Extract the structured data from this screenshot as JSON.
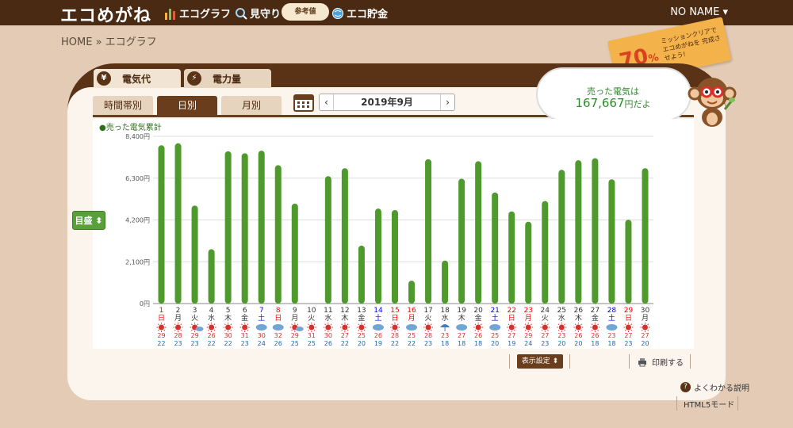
{
  "header": {
    "logo": "エコめがね",
    "nav": [
      {
        "label": "エコグラフ",
        "icon": "bar-chart-icon"
      },
      {
        "label": "見守り",
        "icon": "magnifier-icon"
      },
      {
        "label": "エコ貯金",
        "icon": "globe-coin-icon"
      }
    ],
    "ref_badge": "参考値",
    "user": "NO NAME ▾"
  },
  "breadcrumb": "HOME » エコグラフ",
  "mission": {
    "percent": "70",
    "percent_unit": "%",
    "text": "ミッションクリアで エコめがねを 完成させよう!"
  },
  "tabs": [
    {
      "label": "電気代",
      "icon": "yen-icon"
    },
    {
      "label": "電力量",
      "icon": "bolt-icon"
    }
  ],
  "subtabs": [
    "時間帯別",
    "日別",
    "月別"
  ],
  "active_subtab": 1,
  "date_label": "2019年9月",
  "bubble": {
    "line1": "売った電気は",
    "value": "167,667",
    "unit": "円だよ"
  },
  "legend": "●売った電気累計",
  "target_button": "目盛 ⬍",
  "chart_data": {
    "type": "bar",
    "title": "売った電気累計",
    "yticks": [
      "8,400円",
      "6,300円",
      "4,200円",
      "2,100円",
      "0円"
    ],
    "ylim": [
      0,
      8400
    ],
    "bar_color": "#4f9a2c",
    "categories": [
      "1",
      "2",
      "3",
      "4",
      "5",
      "6",
      "7",
      "8",
      "9",
      "10",
      "11",
      "12",
      "13",
      "14",
      "15",
      "16",
      "17",
      "18",
      "19",
      "20",
      "21",
      "22",
      "23",
      "24",
      "25",
      "26",
      "27",
      "28",
      "29",
      "30"
    ],
    "weekdays": [
      "日",
      "月",
      "火",
      "水",
      "木",
      "金",
      "土",
      "日",
      "月",
      "火",
      "水",
      "木",
      "金",
      "土",
      "日",
      "月",
      "火",
      "水",
      "木",
      "金",
      "土",
      "日",
      "月",
      "火",
      "水",
      "木",
      "金",
      "土",
      "日",
      "月"
    ],
    "day_colors": [
      "red",
      "#333",
      "#333",
      "#333",
      "#333",
      "#333",
      "blue",
      "red",
      "#333",
      "#333",
      "#333",
      "#333",
      "#333",
      "blue",
      "red",
      "red",
      "#333",
      "#333",
      "#333",
      "#333",
      "blue",
      "red",
      "red",
      "#333",
      "#333",
      "#333",
      "#333",
      "blue",
      "red",
      "#333"
    ],
    "values": [
      7950,
      8050,
      4920,
      2730,
      7650,
      7550,
      7680,
      6950,
      5020,
      0,
      6400,
      6800,
      2910,
      4770,
      4700,
      1150,
      7250,
      2160,
      6270,
      7150,
      5580,
      4630,
      4110,
      5150,
      6720,
      7200,
      7300,
      6240,
      4210,
      6800
    ],
    "weather": [
      "sun",
      "sun",
      "sun-cloud",
      "sun",
      "sun",
      "sun",
      "cloud",
      "cloud",
      "sun-cloud",
      "sun",
      "sun",
      "sun",
      "sun",
      "cloud",
      "sun",
      "cloud",
      "sun",
      "umbrella",
      "cloud",
      "sun",
      "cloud",
      "sun",
      "sun",
      "sun",
      "sun",
      "sun",
      "sun",
      "cloud",
      "sun",
      "sun"
    ],
    "temp_high": [
      "29",
      "28",
      "29",
      "26",
      "30",
      "31",
      "30",
      "32",
      "29",
      "31",
      "30",
      "27",
      "25",
      "26",
      "28",
      "25",
      "28",
      "23",
      "27",
      "26",
      "25",
      "27",
      "29",
      "27",
      "23",
      "26",
      "26",
      "23",
      "27",
      "27"
    ],
    "temp_low": [
      "22",
      "23",
      "23",
      "22",
      "22",
      "23",
      "24",
      "26",
      "25",
      "25",
      "26",
      "22",
      "20",
      "19",
      "22",
      "22",
      "23",
      "18",
      "18",
      "18",
      "20",
      "19",
      "24",
      "23",
      "20",
      "20",
      "18",
      "18",
      "23",
      "20"
    ]
  },
  "footer": {
    "display_settings": "表示設定 ⬍",
    "print": "印刷する",
    "help": "よくわかる説明",
    "html5": "HTML5モード"
  },
  "colors": {
    "brown": "#5a3316",
    "green": "#4f9a2c",
    "background": "#e4cbb5"
  }
}
